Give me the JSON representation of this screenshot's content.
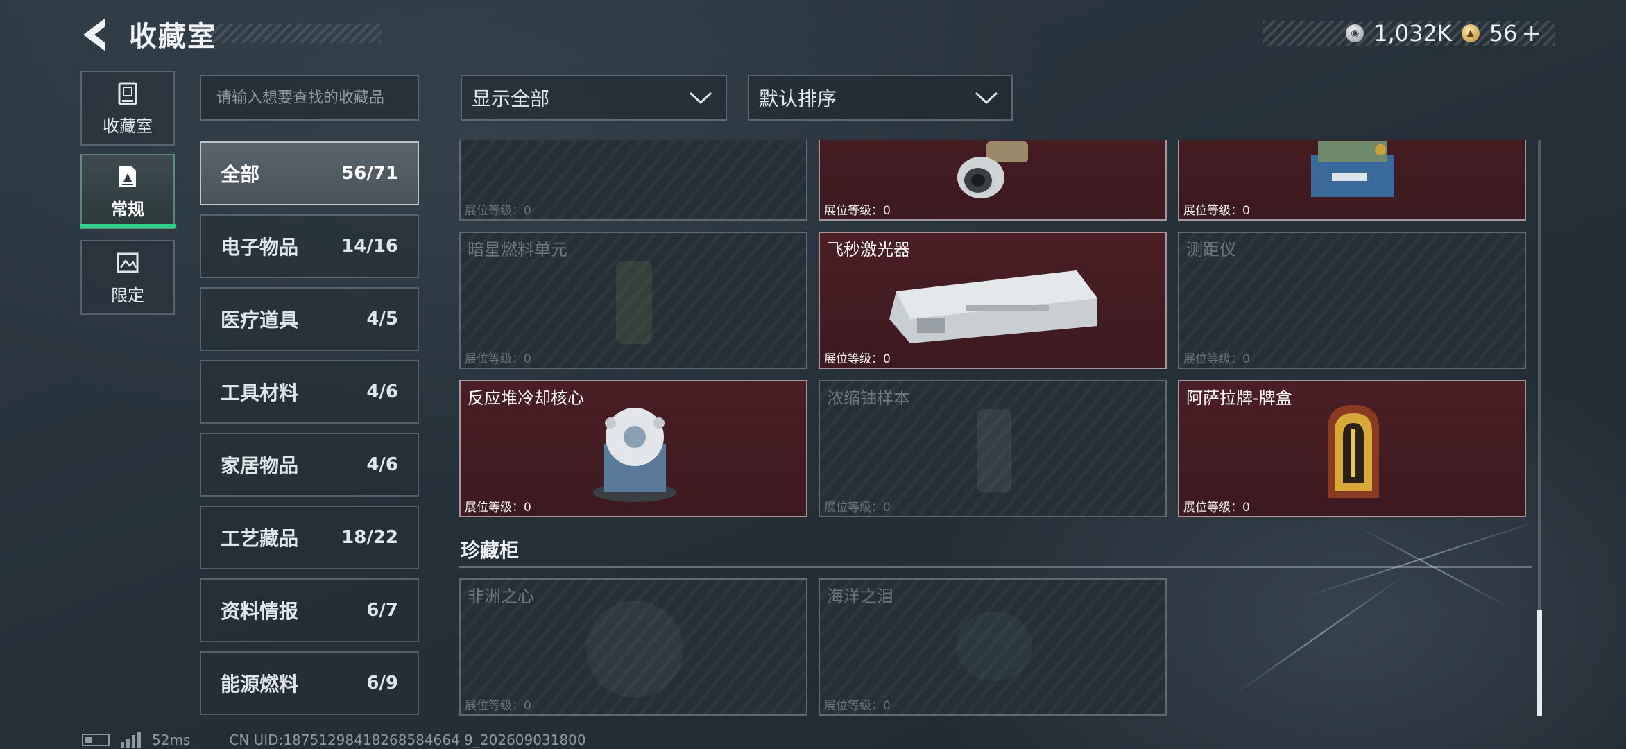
{
  "header": {
    "title": "收藏室",
    "currency": [
      {
        "icon": "silver-coin-icon",
        "value": "1,032K"
      },
      {
        "icon": "gold-coin-icon",
        "value": "56"
      }
    ],
    "add_label": "+"
  },
  "nav": [
    {
      "label": "收藏室",
      "icon": "collection-room-icon"
    },
    {
      "label": "常规",
      "icon": "regular-icon",
      "active": true
    },
    {
      "label": "限定",
      "icon": "limited-icon"
    }
  ],
  "search": {
    "placeholder": "请输入想要查找的收藏品",
    "value": ""
  },
  "categories": [
    {
      "name": "全部",
      "count": "56/71",
      "active": true
    },
    {
      "name": "电子物品",
      "count": "14/16"
    },
    {
      "name": "医疗道具",
      "count": "4/5"
    },
    {
      "name": "工具材料",
      "count": "4/6"
    },
    {
      "name": "家居物品",
      "count": "4/6"
    },
    {
      "name": "工艺藏品",
      "count": "18/22"
    },
    {
      "name": "资料情报",
      "count": "6/7"
    },
    {
      "name": "能源燃料",
      "count": "6/9"
    }
  ],
  "filters": {
    "display": "显示全部",
    "sort": "默认排序"
  },
  "grid": {
    "rows": [
      [
        {
          "name": "",
          "level": "展位等级：0",
          "owned": false
        },
        {
          "name": "",
          "level": "展位等级：0",
          "owned": true
        },
        {
          "name": "",
          "level": "展位等级：0",
          "owned": true
        }
      ],
      [
        {
          "name": "暗星燃料单元",
          "level": "展位等级：0",
          "owned": false
        },
        {
          "name": "飞秒激光器",
          "level": "展位等级：0",
          "owned": true
        },
        {
          "name": "测距仪",
          "level": "展位等级：0",
          "owned": false
        }
      ],
      [
        {
          "name": "反应堆冷却核心",
          "level": "展位等级：0",
          "owned": true
        },
        {
          "name": "浓缩铀样本",
          "level": "展位等级：0",
          "owned": false
        },
        {
          "name": "阿萨拉牌-牌盒",
          "level": "展位等级：0",
          "owned": true
        }
      ]
    ],
    "section_title": "珍藏柜",
    "section_items": [
      {
        "name": "非洲之心",
        "level": "展位等级：0",
        "owned": false
      },
      {
        "name": "海洋之泪",
        "level": "展位等级：0",
        "owned": false
      }
    ]
  },
  "footer": {
    "ping": "52ms",
    "uid": "CN UID:18751298418268584664 9_202609031800"
  },
  "colors": {
    "accent_green": "#2fd08a",
    "owned_card": "#4a1e24",
    "locked_card": "#262f36"
  }
}
